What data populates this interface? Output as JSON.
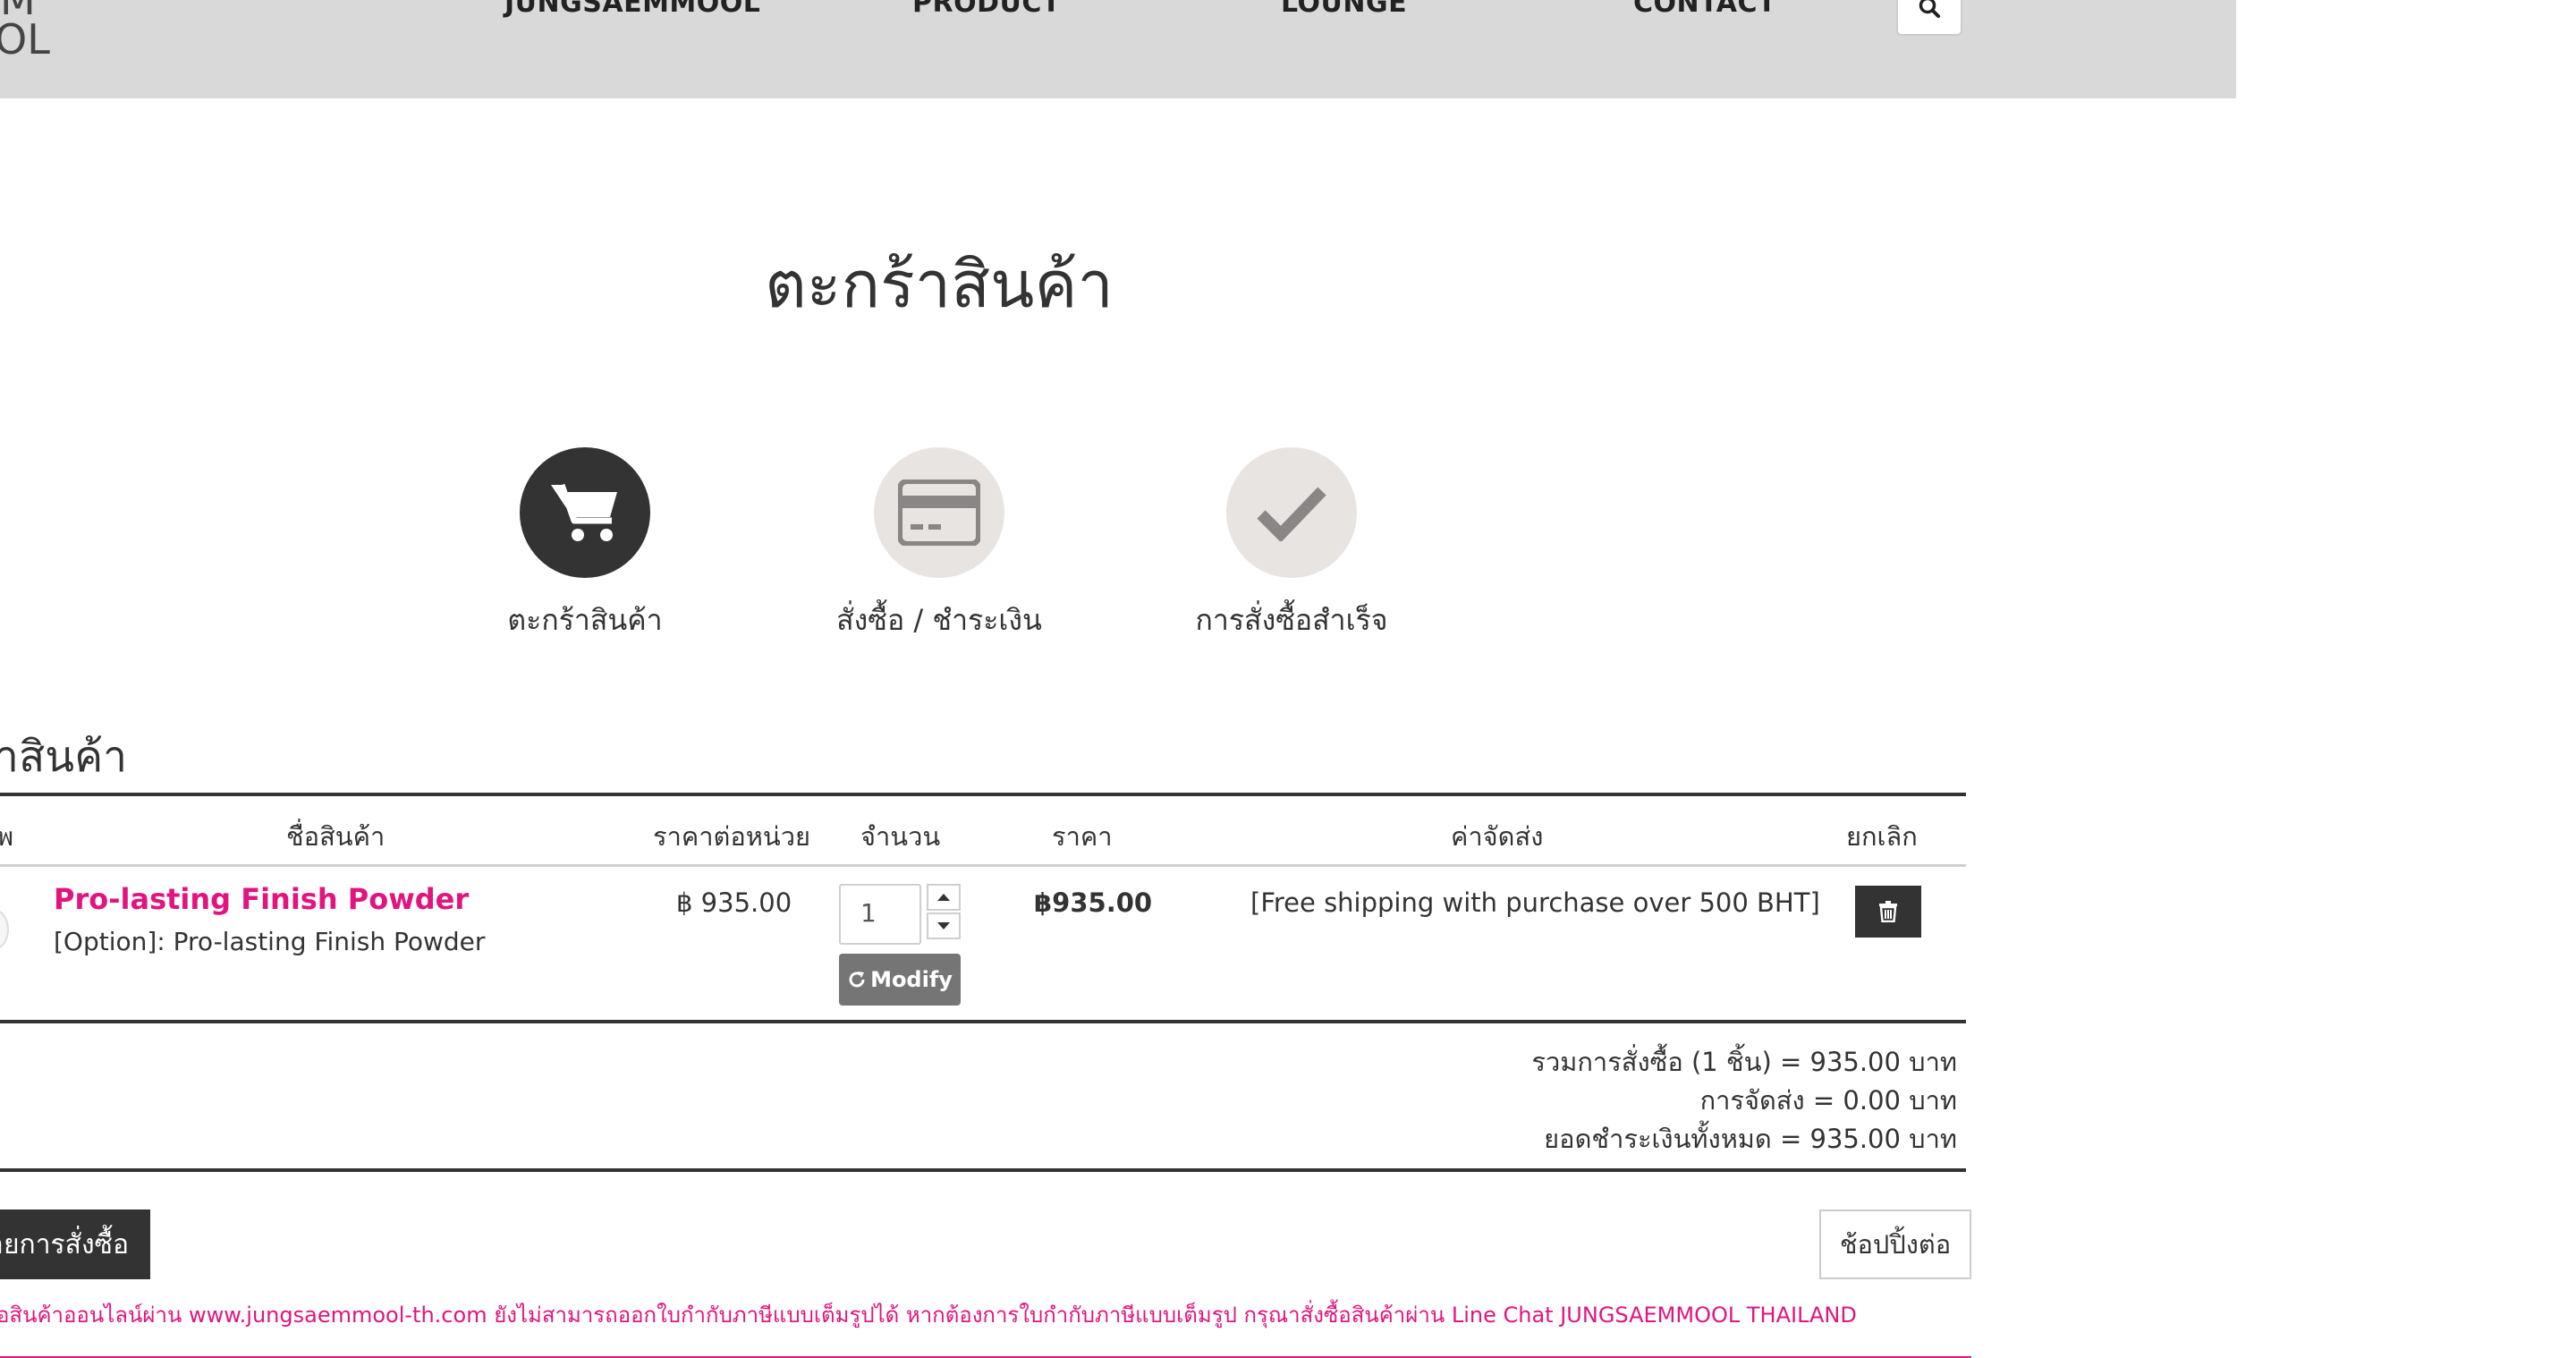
{
  "header": {
    "logo_line1": "M",
    "logo_line2": "OL",
    "nav": [
      "JUNGSAEMMOOL",
      "PRODUCT",
      "LOUNGE",
      "CONTACT"
    ],
    "search_icon": "search-icon"
  },
  "page_title": "ตะกร้าสินค้า",
  "steps": [
    {
      "label": "ตะกร้าสินค้า",
      "icon": "cart-icon",
      "state": "active"
    },
    {
      "label": "สั่งซื้อ / ชำระเงิน",
      "icon": "credit-card-icon",
      "state": "inactive"
    },
    {
      "label": "การสั่งซื้อสำเร็จ",
      "icon": "check-icon",
      "state": "inactive"
    }
  ],
  "section_title": "าสินค้า",
  "table": {
    "headers": [
      "พ",
      "ชื่อสินค้า",
      "ราคาต่อหน่วย",
      "จำนวน",
      "ราคา",
      "ค่าจัดส่ง",
      "ยกเลิก"
    ],
    "row": {
      "product_name": "Pro-lasting Finish Powder",
      "option": "[Option]: Pro-lasting Finish Powder",
      "unit_price": "฿ 935.00",
      "quantity": "1",
      "modify_label": "Modify",
      "price": "฿935.00",
      "shipping": "[Free shipping with purchase over 500 BHT]"
    }
  },
  "summary": {
    "subtotal": "รวมการสั่งซื้อ (1 ชิ้น) = 935.00 บาท",
    "shipping": "การจัดส่ง = 0.00 บาท",
    "total": "ยอดชำระเงินทั้งหมด = 935.00 บาท"
  },
  "actions": {
    "order_label": "ายการสั่งซื้อ",
    "continue_label": "ช้อปปิ้งต่อ"
  },
  "notice": "อสินค้าออนไลน์ผ่าน www.jungsaemmool-th.com ยังไม่สามารถออกใบกำกับภาษีแบบเต็มรูปได้ หากต้องการใบกำกับภาษีแบบเต็มรูป กรุณาสั่งซื้อสินค้าผ่าน Line Chat JUNGSAEMMOOL THAILAND",
  "colors": {
    "accent": "#e0157f",
    "dark": "#333333",
    "header_bg": "#d9d9d9",
    "step_inactive": "#e8e4e2"
  }
}
